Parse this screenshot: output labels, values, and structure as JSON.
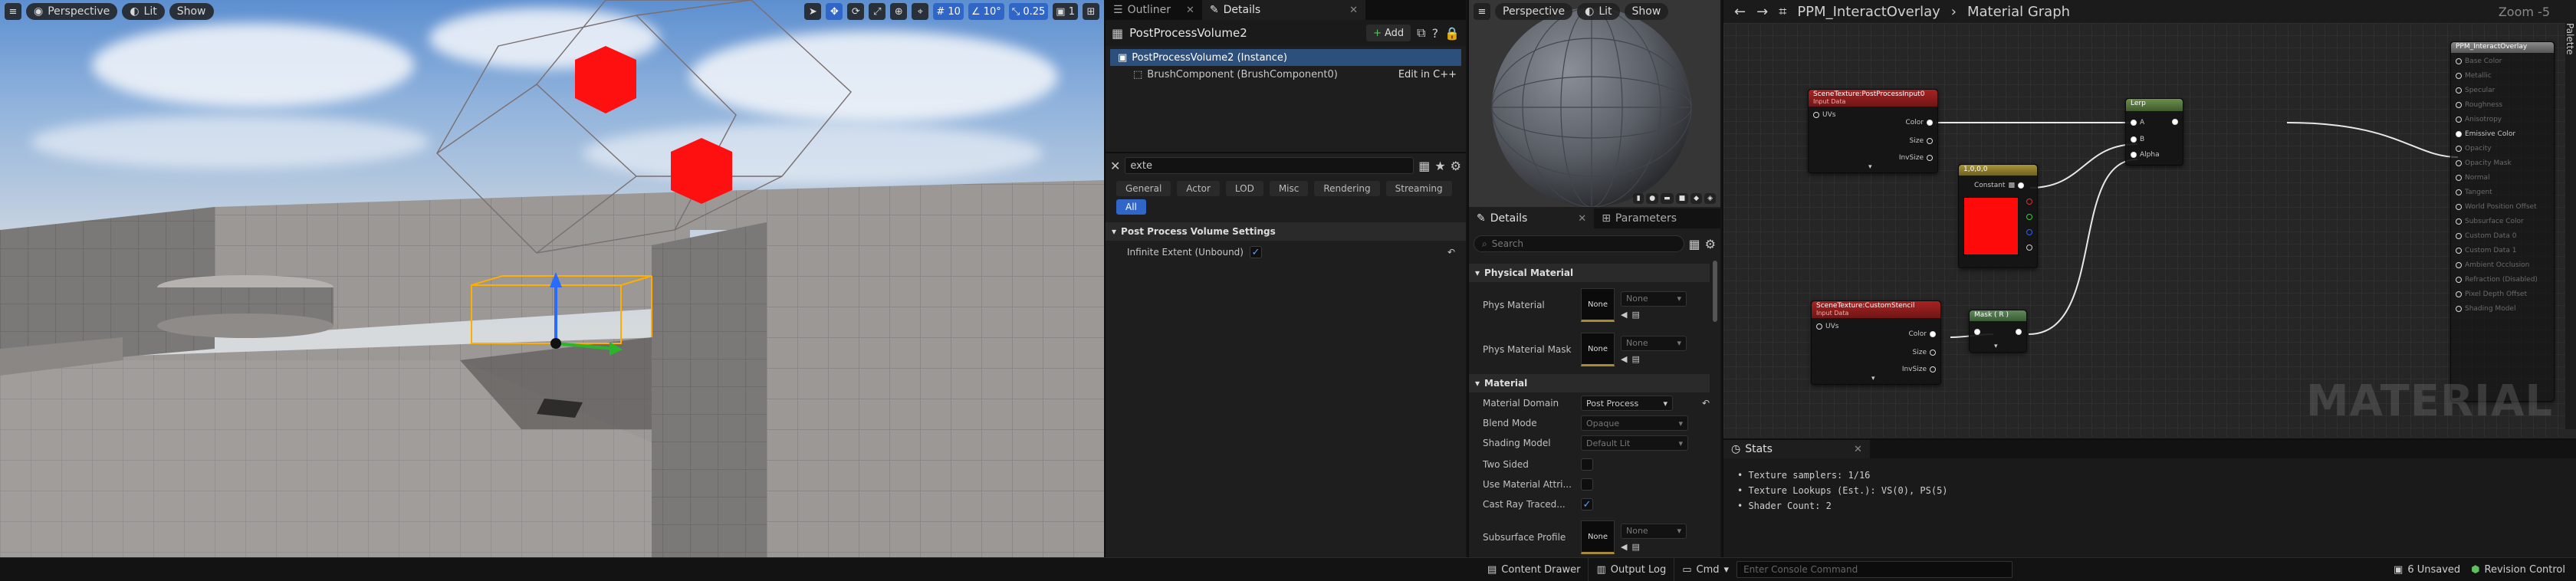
{
  "viewport": {
    "mode_label": "Perspective",
    "lit_label": "Lit",
    "show_label": "Show",
    "grid_size": "10",
    "rotation_snap": "10°",
    "scale_snap": "0.25",
    "camera_speed": "1"
  },
  "outliner": {
    "tab_outliner": "Outliner",
    "tab_details": "Details",
    "actor_name": "PostProcessVolume2",
    "add_label": "Add",
    "rows": [
      {
        "label": "PostProcessVolume2 (Instance)"
      },
      {
        "label": "BrushComponent (BrushComponent0)",
        "link": "Edit in C++"
      }
    ],
    "search_value": "exte",
    "filters": [
      "General",
      "Actor",
      "LOD",
      "Misc",
      "Rendering",
      "Streaming"
    ],
    "filter_all": "All",
    "category": "Post Process Volume Settings",
    "property_label": "Infinite Extent (Unbound)"
  },
  "preview": {
    "mode_label": "Perspective",
    "lit_label": "Lit",
    "show_label": "Show"
  },
  "material_details": {
    "tab_details": "Details",
    "tab_parameters": "Parameters",
    "search_placeholder": "Search",
    "cat_physical": "Physical Material",
    "phys_material": "Phys Material",
    "phys_material_mask": "Phys Material Mask",
    "none": "None",
    "cat_material": "Material",
    "material_domain": "Material Domain",
    "material_domain_value": "Post Process",
    "blend_mode": "Blend Mode",
    "blend_mode_value": "Opaque",
    "shading_model": "Shading Model",
    "shading_model_value": "Default Lit",
    "two_sided": "Two Sided",
    "use_material_attr": "Use Material Attri...",
    "cast_ray_traced": "Cast Ray Traced...",
    "subsurface_profile": "Subsurface Profile"
  },
  "graph": {
    "breadcrumb_asset": "PPM_InteractOverlay",
    "breadcrumb_sep": "›",
    "breadcrumb_page": "Material Graph",
    "zoom": "Zoom -5",
    "palette": "Palette",
    "watermark": "MATERIAL",
    "node_scene1_title": "SceneTexture:PostProcessInput0",
    "node_scene1_sub": "Input Data",
    "node_scene2_title": "SceneTexture:CustomStencil",
    "node_scene2_sub": "Input Data",
    "node_lerp_title": "Lerp",
    "node_const_title": "1,0,0,0",
    "node_const_label": "Constant",
    "node_mask_title": "Mask ( R )",
    "pin_uvs": "UVs",
    "pin_color": "Color",
    "pin_size": "Size",
    "pin_invsize": "InvSize",
    "pin_a": "A",
    "pin_b": "B",
    "pin_alpha": "Alpha",
    "output_title": "PPM_InteractOverlay",
    "output_pins": [
      "Base Color",
      "Metallic",
      "Specular",
      "Roughness",
      "Anisotropy",
      "Emissive Color",
      "Opacity",
      "Opacity Mask",
      "Normal",
      "Tangent",
      "World Position Offset",
      "Subsurface Color",
      "Custom Data 0",
      "Custom Data 1",
      "Ambient Occlusion",
      "Refraction (Disabled)",
      "Pixel Depth Offset",
      "Shading Model"
    ],
    "emissive_index": 5
  },
  "stats": {
    "tab_label": "Stats",
    "lines": [
      "• Texture samplers: 1/16",
      "• Texture Lookups (Est.): VS(0), PS(5)",
      "• Shader Count: 2"
    ]
  },
  "bottom_bar": {
    "content_drawer": "Content Drawer",
    "output_log": "Output Log",
    "cmd": "Cmd",
    "console_placeholder": "Enter Console Command",
    "unsaved": "6 Unsaved",
    "revision_control": "Revision Control"
  },
  "colors": {
    "accent": "#2f66c8",
    "red_cube": "#ff1010",
    "scene_node": "#8e1a1a",
    "lerp_node": "#4f6b3a",
    "const_node": "#8a7a2a",
    "mask_node": "#4c6b48",
    "output_node": "#6e6e6e"
  }
}
